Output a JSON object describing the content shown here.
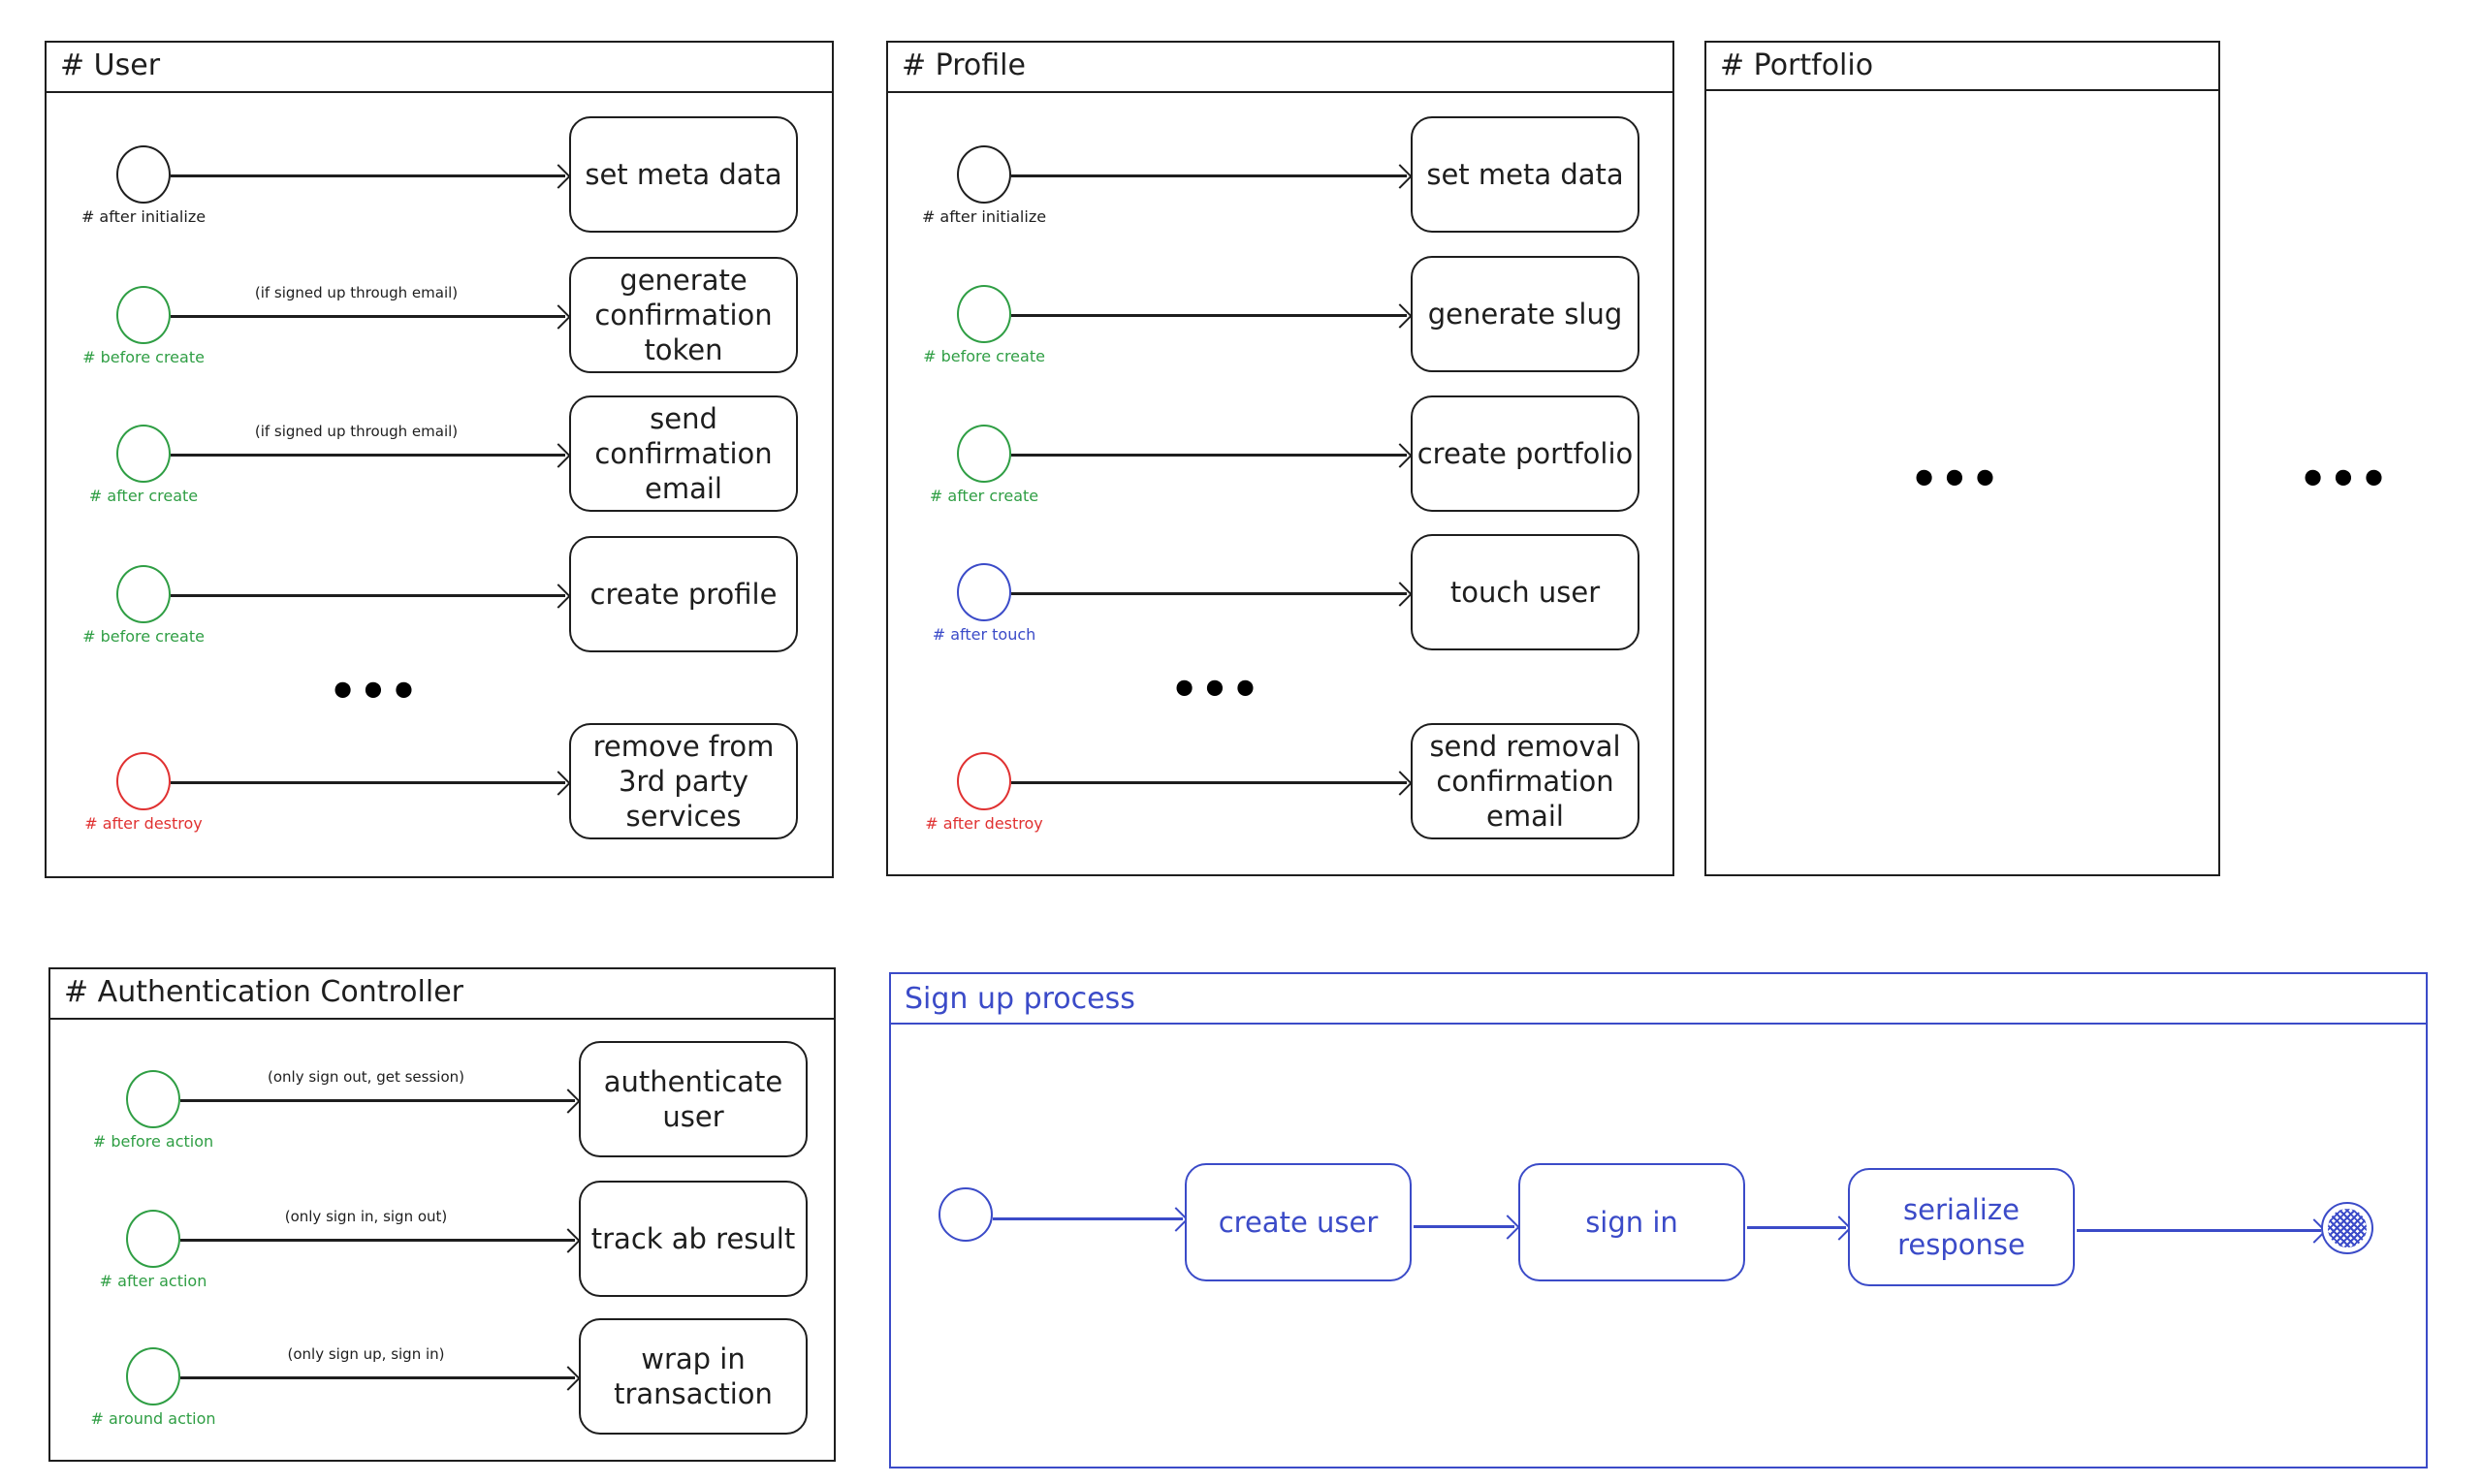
{
  "colors": {
    "stroke": "#1e1e1e",
    "green": "#2f9e44",
    "red": "#e03131",
    "blue": "#3b4bc8"
  },
  "user": {
    "title": "# User",
    "rows": [
      {
        "event": "# after initialize",
        "color": "black",
        "condition": "",
        "action": "set meta data"
      },
      {
        "event": "# before create",
        "color": "green",
        "condition": "(if signed up through email)",
        "action": "generate confirmation token"
      },
      {
        "event": "# after create",
        "color": "green",
        "condition": "(if signed up through email)",
        "action": "send confirmation email"
      },
      {
        "event": "# before create",
        "color": "green",
        "condition": "",
        "action": "create profile"
      },
      {
        "event": "# after destroy",
        "color": "red",
        "condition": "",
        "action": "remove from 3rd party services"
      }
    ],
    "ellipsis": "•••"
  },
  "profile": {
    "title": "# Profile",
    "rows": [
      {
        "event": "# after initialize",
        "color": "black",
        "condition": "",
        "action": "set meta data"
      },
      {
        "event": "# before create",
        "color": "green",
        "condition": "",
        "action": "generate slug"
      },
      {
        "event": "# after create",
        "color": "green",
        "condition": "",
        "action": "create portfolio"
      },
      {
        "event": "# after touch",
        "color": "blue",
        "condition": "",
        "action": "touch user"
      },
      {
        "event": "# after destroy",
        "color": "red",
        "condition": "",
        "action": "send removal confirmation email"
      }
    ],
    "ellipsis": "•••"
  },
  "portfolio": {
    "title": "# Portfolio",
    "ellipsis": "•••"
  },
  "outer_ellipsis": "•••",
  "auth": {
    "title": "# Authentication Controller",
    "rows": [
      {
        "event": "# before action",
        "color": "green",
        "condition": "(only sign out, get session)",
        "action": "authenticate user"
      },
      {
        "event": "# after action",
        "color": "green",
        "condition": "(only sign in, sign out)",
        "action": "track ab result"
      },
      {
        "event": "# around action",
        "color": "green",
        "condition": "(only sign up, sign in)",
        "action": "wrap in transaction"
      }
    ]
  },
  "signup": {
    "title": "Sign up process",
    "steps": [
      "create user",
      "sign in",
      "serialize response"
    ]
  }
}
